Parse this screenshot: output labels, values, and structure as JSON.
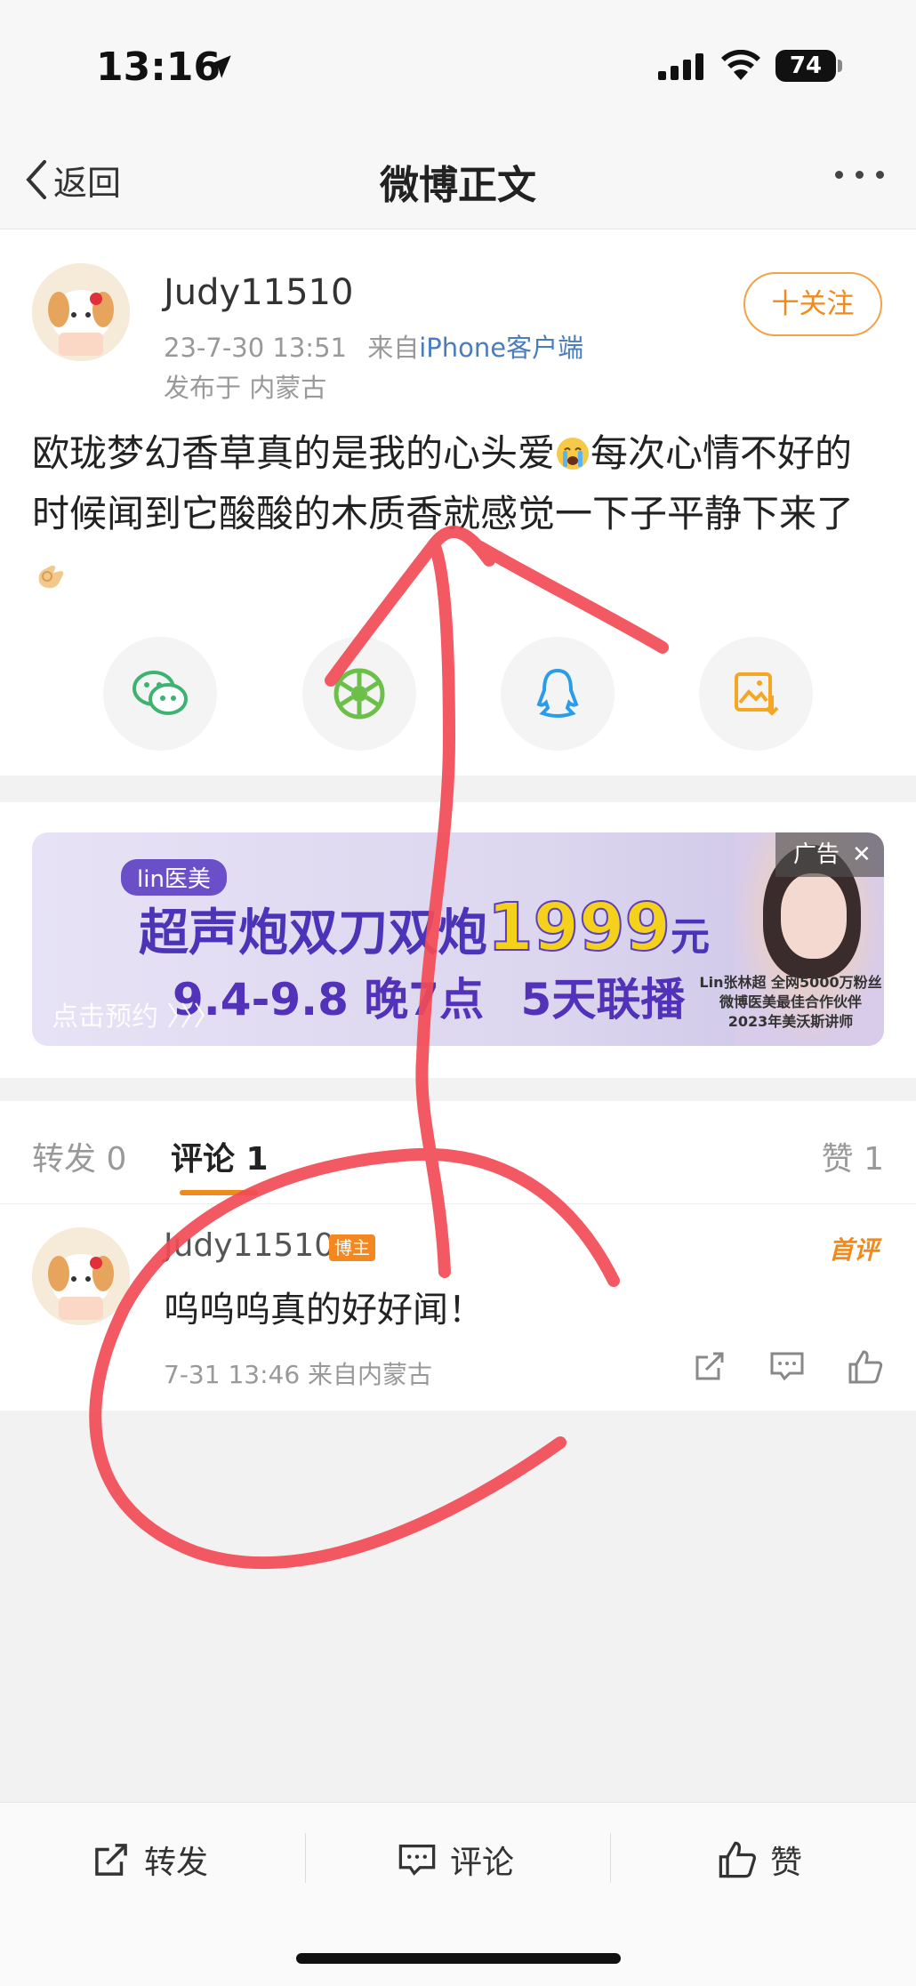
{
  "status_bar": {
    "time": "13:16",
    "battery": "74"
  },
  "nav": {
    "back_label": "返回",
    "title": "微博正文"
  },
  "post": {
    "username": "Judy11510",
    "time": "23-7-30 13:51",
    "source_prefix": "来自",
    "source": "iPhone客户端",
    "location": "发布于 内蒙古",
    "follow_label": "十关注",
    "content_1": "欧珑梦幻香草真的是我的心头爱",
    "content_2": "每次心情不好的时候闻到它酸酸的木质香就感觉一下子平静下来了",
    "emoji_1": "crying-face-icon",
    "emoji_2": "ok-hand-icon"
  },
  "share_icons": [
    "wechat-icon",
    "moments-icon",
    "qq-icon",
    "save-image-icon"
  ],
  "ad": {
    "brand": "lin医美",
    "headline": "超声炮双刀双炮",
    "price": "1999",
    "unit": "元",
    "dates": "9.4-9.8 晚7点",
    "days": "5天联播",
    "cta": "点击预约 〉〉〉",
    "tag": "广告",
    "small_1": "Lin张林超 全网5000万粉丝",
    "small_2": "微博医美最佳合作伙伴",
    "small_3": "2023年美沃斯讲师"
  },
  "tabs": {
    "repost": "转发 0",
    "comment": "评论 1",
    "like": "赞 1"
  },
  "comment": {
    "username": "Judy11510",
    "badge": "博主",
    "first_label": "首评",
    "text": "呜呜呜真的好好闻！",
    "meta": "7-31 13:46  来自内蒙古"
  },
  "bottom_bar": {
    "repost": "转发",
    "comment": "评论",
    "like": "赞"
  },
  "colors": {
    "accent": "#f08a1c",
    "link": "#4a7dbd",
    "annotation": "#f24b55"
  }
}
